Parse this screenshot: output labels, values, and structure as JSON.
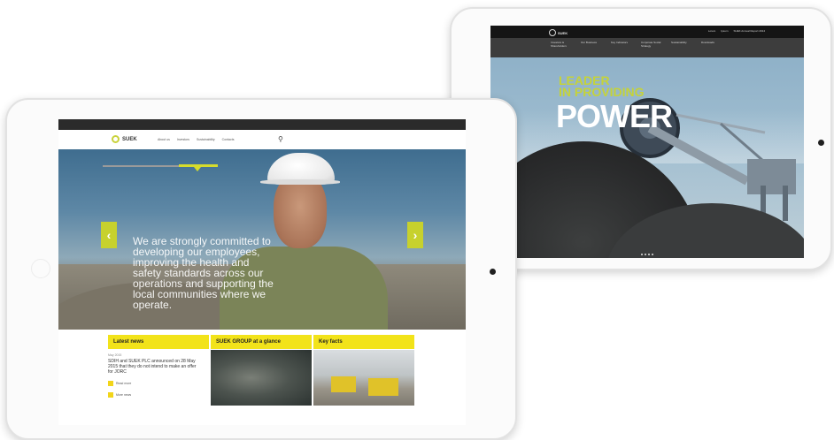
{
  "back_screen": {
    "logo": "SUEK",
    "top_links": [
      "Lorem",
      "Ipsum",
      "SUEK Annual Report 2014"
    ],
    "nav_items": [
      "Investors & Shareholders",
      "Our Business",
      "Key Indicators",
      "Corporate Social Strategy",
      "Sustainability",
      "Downloads"
    ],
    "headline_small": "LEADER\nIN PROVIDING",
    "headline_big": "POWER"
  },
  "front_screen": {
    "logo": "SUEK",
    "nav_links": [
      "About us",
      "Investors",
      "Sustainability",
      "Contacts"
    ],
    "hero_text": "We are strongly committed to developing our employees, improving the health and safety standards across our operations and supporting the local communities where we operate.",
    "news": {
      "title": "Latest news",
      "date": "May 2015",
      "body": "SDIH and SUEK PLC announced on 28 May 2015 that they do not intend to make an offer for JORC",
      "button_read": "Read more",
      "button_more": "More news"
    },
    "glance": {
      "title": "SUEK GROUP at a glance"
    },
    "key_facts": {
      "title": "Key facts"
    }
  },
  "colors": {
    "accent_yellow": "#f2e31a",
    "accent_green": "#c7d12d"
  }
}
